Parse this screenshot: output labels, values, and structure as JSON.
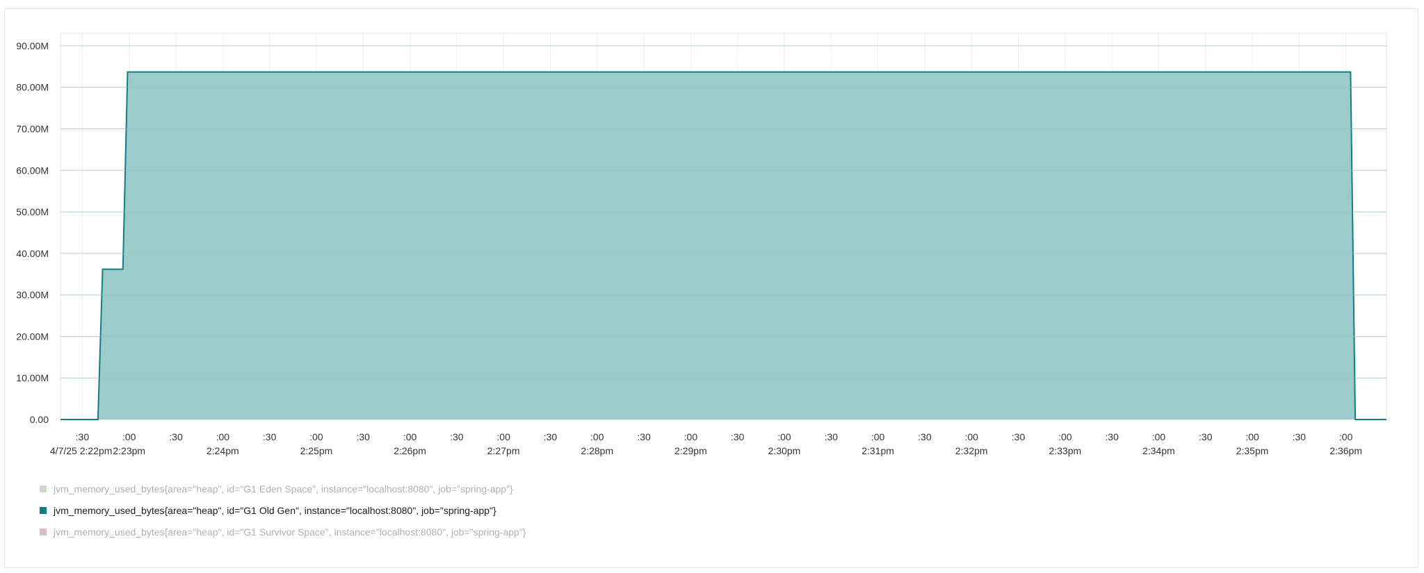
{
  "chart_data": {
    "type": "area",
    "y_ticks": [
      "0.00",
      "10.00M",
      "20.00M",
      "30.00M",
      "40.00M",
      "50.00M",
      "60.00M",
      "70.00M",
      "80.00M",
      "90.00M"
    ],
    "ylim": [
      0,
      93000000
    ],
    "x_ticks": [
      {
        "top": ":30",
        "bottom": "4/7/25 2:22pm"
      },
      {
        "top": ":00",
        "bottom": "2:23pm"
      },
      {
        "top": ":30",
        "bottom": ""
      },
      {
        "top": ":00",
        "bottom": "2:24pm"
      },
      {
        "top": ":30",
        "bottom": ""
      },
      {
        "top": ":00",
        "bottom": "2:25pm"
      },
      {
        "top": ":30",
        "bottom": ""
      },
      {
        "top": ":00",
        "bottom": "2:26pm"
      },
      {
        "top": ":30",
        "bottom": ""
      },
      {
        "top": ":00",
        "bottom": "2:27pm"
      },
      {
        "top": ":30",
        "bottom": ""
      },
      {
        "top": ":00",
        "bottom": "2:28pm"
      },
      {
        "top": ":30",
        "bottom": ""
      },
      {
        "top": ":00",
        "bottom": "2:29pm"
      },
      {
        "top": ":30",
        "bottom": ""
      },
      {
        "top": ":00",
        "bottom": "2:30pm"
      },
      {
        "top": ":30",
        "bottom": ""
      },
      {
        "top": ":00",
        "bottom": "2:31pm"
      },
      {
        "top": ":30",
        "bottom": ""
      },
      {
        "top": ":00",
        "bottom": "2:32pm"
      },
      {
        "top": ":30",
        "bottom": ""
      },
      {
        "top": ":00",
        "bottom": "2:33pm"
      },
      {
        "top": ":30",
        "bottom": ""
      },
      {
        "top": ":00",
        "bottom": "2:34pm"
      },
      {
        "top": ":30",
        "bottom": ""
      },
      {
        "top": ":00",
        "bottom": "2:35pm"
      },
      {
        "top": ":30",
        "bottom": ""
      },
      {
        "top": ":00",
        "bottom": "2:36pm"
      }
    ],
    "x_start_seconds": 136,
    "x_end_seconds": 986,
    "tick_start_seconds": 150,
    "tick_step_seconds": 30,
    "series": [
      {
        "name": "jvm_memory_used_bytes{area=\"heap\", id=\"G1 Old Gen\", instance=\"localhost:8080\", job=\"spring-app\"}",
        "color": "#117e80",
        "fill": "#9bcccb",
        "points": [
          [
            136,
            0
          ],
          [
            160,
            0
          ],
          [
            163,
            36200000
          ],
          [
            176,
            36200000
          ],
          [
            179,
            83700000
          ],
          [
            963,
            83700000
          ],
          [
            966,
            0
          ],
          [
            986,
            0
          ]
        ]
      }
    ],
    "grid": true,
    "legend_position": "bottom-left"
  },
  "legend": [
    {
      "label": "jvm_memory_used_bytes{area=\"heap\", id=\"G1 Eden Space\", instance=\"localhost:8080\", job=\"spring-app\"}",
      "color": "#c2dfc0",
      "state": "hidden"
    },
    {
      "label": "jvm_memory_used_bytes{area=\"heap\", id=\"G1 Old Gen\", instance=\"localhost:8080\", job=\"spring-app\"}",
      "color": "#117e80",
      "state": "active"
    },
    {
      "label": "jvm_memory_used_bytes{area=\"heap\", id=\"G1 Survivor Space\", instance=\"localhost:8080\", job=\"spring-app\"}",
      "color": "#e1bdbd",
      "state": "hidden"
    }
  ]
}
